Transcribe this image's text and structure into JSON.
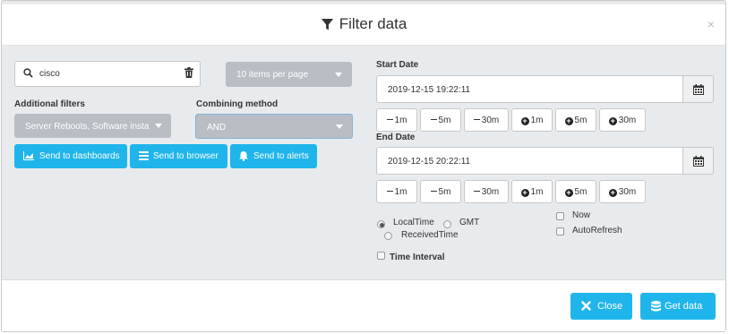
{
  "modal": {
    "title": "Filter data",
    "close_glyph": "×"
  },
  "search": {
    "value": "cisco",
    "icon": "search-icon",
    "clear_icon": "trash-icon"
  },
  "pagination": {
    "selected": "10 items per page"
  },
  "additional_filters": {
    "label": "Additional filters",
    "selected": "Server Reboots, Software installa"
  },
  "combining": {
    "label": "Combining method",
    "selected": "AND"
  },
  "actions": [
    {
      "label": "Send to dashboards",
      "icon": "area-chart-icon"
    },
    {
      "label": "Send to browser",
      "icon": "list-icon"
    },
    {
      "label": "Send to alerts",
      "icon": "bell-icon"
    }
  ],
  "start_date": {
    "label": "Start Date",
    "value": "2019-12-15 19:22:11",
    "steps": [
      "1m",
      "5m",
      "30m",
      "1m",
      "5m",
      "30m"
    ]
  },
  "end_date": {
    "label": "End Date",
    "value": "2019-12-15 20:22:11",
    "steps": [
      "1m",
      "5m",
      "30m",
      "1m",
      "5m",
      "30m"
    ]
  },
  "time_mode": {
    "options": [
      "LocalTime",
      "GMT",
      "ReceivedTime"
    ],
    "selected": "LocalTime"
  },
  "checks": {
    "now": "Now",
    "autorefresh": "AutoRefresh",
    "time_interval": "Time Interval"
  },
  "footer": {
    "close_label": "Close",
    "get_label": "Get data"
  },
  "colors": {
    "accent": "#1fb5ea",
    "panel": "#e8ebee",
    "grey_button": "#b8bec4",
    "focus_border": "#7fb3d8"
  }
}
